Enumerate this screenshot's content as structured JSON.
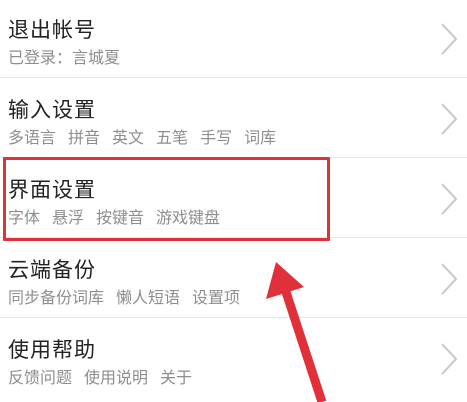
{
  "rows": [
    {
      "title": "退出帐号",
      "sub": [
        "已登录：言城夏"
      ]
    },
    {
      "title": "输入设置",
      "sub": [
        "多语言",
        "拼音",
        "英文",
        "五笔",
        "手写",
        "词库"
      ]
    },
    {
      "title": "界面设置",
      "sub": [
        "字体",
        "悬浮",
        "按键音",
        "游戏键盘"
      ]
    },
    {
      "title": "云端备份",
      "sub": [
        "同步备份词库",
        "懒人短语",
        "设置项"
      ]
    },
    {
      "title": "使用帮助",
      "sub": [
        "反馈问题",
        "使用说明",
        "关于"
      ]
    }
  ],
  "icons": {
    "chevron": "chevron-right-icon"
  },
  "colors": {
    "highlight": "#e0313a",
    "arrow": "#e0313a",
    "title": "#222222",
    "subtitle": "#8e8e8e",
    "chevron": "#c8c8c8"
  }
}
